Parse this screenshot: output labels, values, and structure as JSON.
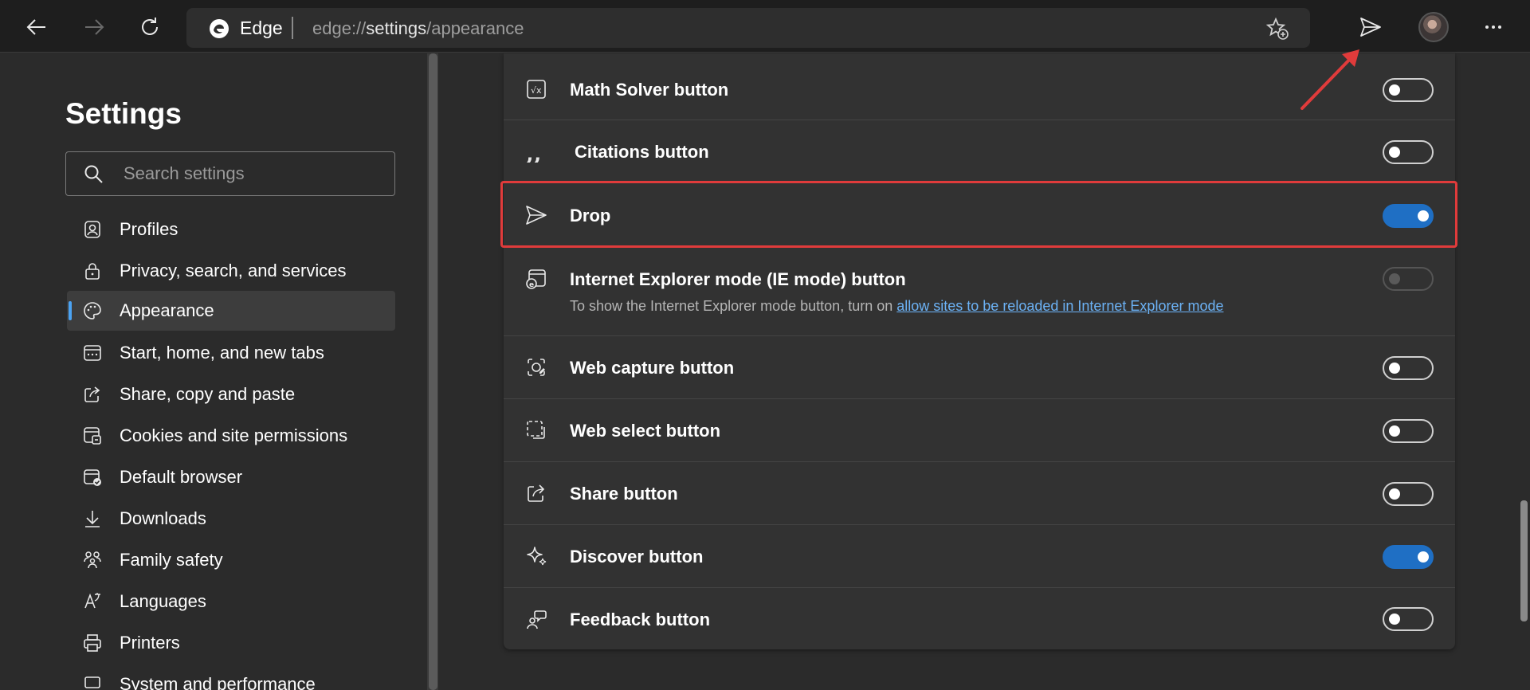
{
  "toolbar": {
    "brand": "Edge",
    "url_prefix": "edge://",
    "url_host": "settings",
    "url_path": "/appearance"
  },
  "sidebar": {
    "title": "Settings",
    "search_placeholder": "Search settings",
    "items": [
      {
        "label": "Profiles",
        "icon": "profile-icon"
      },
      {
        "label": "Privacy, search, and services",
        "icon": "lock-icon"
      },
      {
        "label": "Appearance",
        "icon": "palette-icon",
        "active": true
      },
      {
        "label": "Start, home, and new tabs",
        "icon": "home-tabs-icon"
      },
      {
        "label": "Share, copy and paste",
        "icon": "share-icon"
      },
      {
        "label": "Cookies and site permissions",
        "icon": "cookies-icon"
      },
      {
        "label": "Default browser",
        "icon": "browser-icon"
      },
      {
        "label": "Downloads",
        "icon": "download-icon"
      },
      {
        "label": "Family safety",
        "icon": "family-icon"
      },
      {
        "label": "Languages",
        "icon": "languages-icon"
      },
      {
        "label": "Printers",
        "icon": "printer-icon"
      },
      {
        "label": "System and performance",
        "icon": "system-icon"
      }
    ]
  },
  "main": {
    "rows": [
      {
        "label": "Math Solver button",
        "icon": "math-solver-icon",
        "state": "off"
      },
      {
        "label": "Citations button",
        "icon": "quote-icon",
        "state": "off"
      },
      {
        "label": "Drop",
        "icon": "send-icon",
        "state": "on"
      },
      {
        "label": "Internet Explorer mode (IE mode) button",
        "icon": "ie-mode-icon",
        "state": "disabled",
        "description": "To show the Internet Explorer mode button, turn on ",
        "link": "allow sites to be reloaded in Internet Explorer mode"
      },
      {
        "label": "Web capture button",
        "icon": "web-capture-icon",
        "state": "off"
      },
      {
        "label": "Web select button",
        "icon": "web-select-icon",
        "state": "off"
      },
      {
        "label": "Share button",
        "icon": "share-icon",
        "state": "off"
      },
      {
        "label": "Discover button",
        "icon": "sparkle-icon",
        "state": "on"
      },
      {
        "label": "Feedback button",
        "icon": "feedback-icon",
        "state": "off"
      }
    ]
  },
  "colors": {
    "accent": "#1f6fc4",
    "highlight": "#e03b3b",
    "link": "#6cb2f5"
  }
}
